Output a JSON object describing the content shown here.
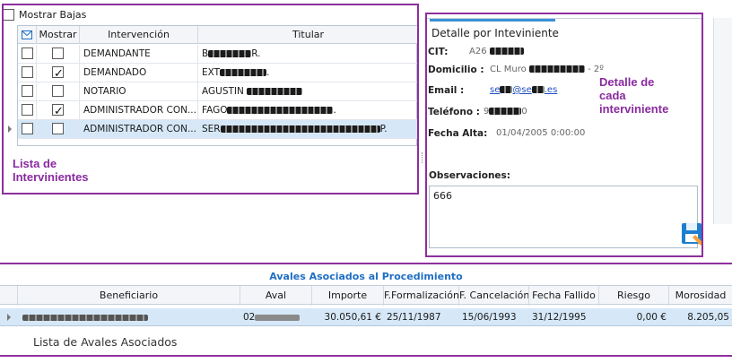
{
  "toolbar": {
    "mostrar_bajas": "Mostrar Bajas"
  },
  "grid": {
    "headers": {
      "mostrar": "Mostrar",
      "intervencion": "Intervención",
      "titular": "Titular"
    },
    "rows": [
      {
        "intervencion": "DEMANDANTE",
        "titular": "B",
        "titular_suffix": "R.",
        "mostrar": false,
        "selected": false
      },
      {
        "intervencion": "DEMANDADO",
        "titular": "EXT",
        "titular_suffix": ".",
        "mostrar": true,
        "selected": false
      },
      {
        "intervencion": "NOTARIO",
        "titular": "AGUSTIN ",
        "titular_suffix": "",
        "mostrar": false,
        "selected": false
      },
      {
        "intervencion": "ADMINISTRADOR CON...",
        "titular": "FAGO",
        "titular_suffix": ".",
        "mostrar": true,
        "selected": false
      },
      {
        "intervencion": "ADMINISTRADOR CON...",
        "titular": "SER",
        "titular_suffix": "P.",
        "mostrar": false,
        "selected": true
      }
    ]
  },
  "annotations": {
    "lista_line1": "Lista de",
    "lista_line2": "Intervinientes",
    "detalle_line1": "Detalle de",
    "detalle_line2": "cada",
    "detalle_line3": "interviniente",
    "avales_caption": "Lista de Avales Asociados"
  },
  "detail": {
    "tab": "Detalle por Inteviniente",
    "cit_label": "CIT:",
    "cit_value": "A26",
    "domicilio_label": "Domicilio :",
    "domicilio_value": "CL Muro ",
    "domicilio_suffix": "- 2º",
    "email_label": "Email :",
    "email_prefix": "se",
    "email_mid": "@se",
    "email_suffix": ".es",
    "telefono_label": "Teléfono :",
    "telefono_prefix": "9",
    "telefono_suffix": "0",
    "fecha_alta_label": "Fecha Alta:",
    "fecha_alta_value": "01/04/2005 0:00:00",
    "observaciones_label": "Observaciones:",
    "observaciones_value": "666"
  },
  "avales": {
    "title": "Avales Asociados al Procedimiento",
    "headers": {
      "beneficiario": "Beneficiario",
      "aval": "Aval",
      "importe": "Importe",
      "fformalizacion": "F.Formalización",
      "fcancelacion": "F. Cancelación",
      "fecha_fallido": "Fecha Fallido",
      "riesgo": "Riesgo",
      "morosidad": "Morosidad"
    },
    "row": {
      "aval_prefix": "02",
      "importe": "30.050,61 €",
      "fformalizacion": "25/11/1987",
      "fcancelacion": "15/06/1993",
      "fecha_fallido": "31/12/1995",
      "riesgo": "0,00 €",
      "morosidad": "8.205,05"
    }
  },
  "colors": {
    "accent": "#8e2f9e",
    "header_blue": "#1f6fc4",
    "selection": "#d6e8f8"
  }
}
